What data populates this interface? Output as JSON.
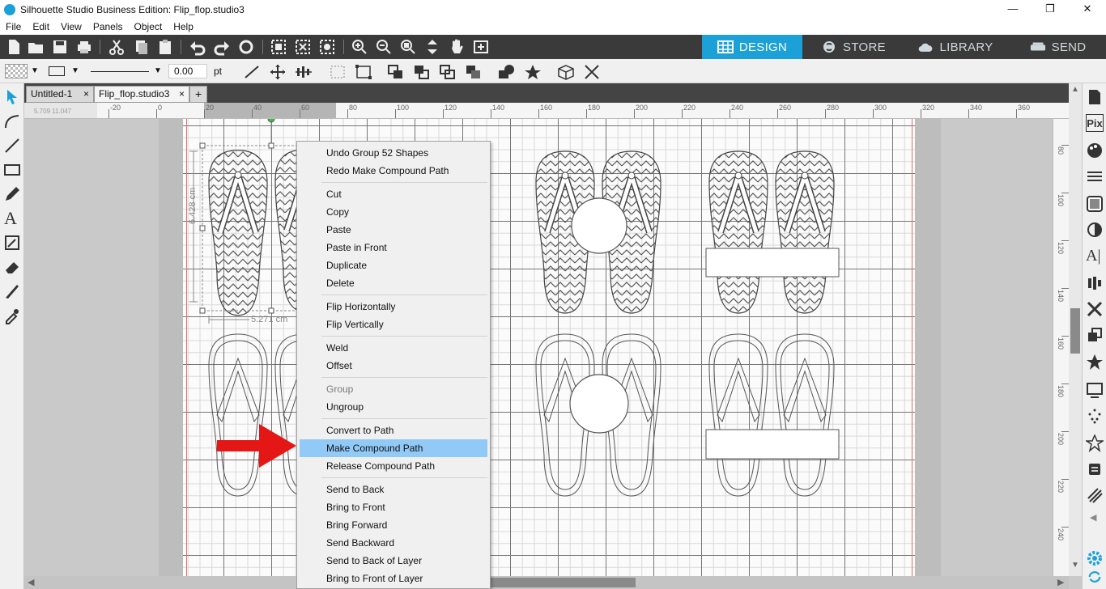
{
  "window": {
    "title": "Silhouette Studio Business Edition: Flip_flop.studio3",
    "controls": [
      "—",
      "❐",
      "✕"
    ]
  },
  "menubar": [
    "File",
    "Edit",
    "View",
    "Panels",
    "Object",
    "Help"
  ],
  "mode_tabs": [
    {
      "label": "DESIGN",
      "active": true
    },
    {
      "label": "STORE",
      "active": false
    },
    {
      "label": "LIBRARY",
      "active": false
    },
    {
      "label": "SEND",
      "active": false
    }
  ],
  "line_settings": {
    "width_value": "0.00",
    "unit": "pt"
  },
  "doc_tabs": [
    {
      "label": "Untitled-1",
      "close": "×"
    },
    {
      "label": "Flip_flop.studio3",
      "close": "×"
    },
    {
      "label": "+"
    }
  ],
  "ruler": {
    "mouse_readout": "5.709  11.047",
    "h_ticks": [
      "-20",
      "0",
      "20",
      "40",
      "60",
      "80",
      "100",
      "120",
      "140",
      "160",
      "180",
      "200",
      "220",
      "240",
      "260",
      "280",
      "300",
      "320",
      "340",
      "360"
    ],
    "v_ticks": [
      "80",
      "100",
      "120",
      "140",
      "160",
      "180",
      "200",
      "220",
      "240"
    ]
  },
  "selection": {
    "height_label": "6.428 cm",
    "width_label": "5.271 cm"
  },
  "context_menu": {
    "groups": [
      [
        {
          "label": "Undo Group 52 Shapes"
        },
        {
          "label": "Redo Make Compound Path"
        }
      ],
      [
        {
          "label": "Cut"
        },
        {
          "label": "Copy"
        },
        {
          "label": "Paste"
        },
        {
          "label": "Paste in Front"
        },
        {
          "label": "Duplicate"
        },
        {
          "label": "Delete"
        }
      ],
      [
        {
          "label": "Flip Horizontally"
        },
        {
          "label": "Flip Vertically"
        }
      ],
      [
        {
          "label": "Weld"
        },
        {
          "label": "Offset"
        }
      ],
      [
        {
          "label": "Group",
          "disabled": true
        },
        {
          "label": "Ungroup"
        }
      ],
      [
        {
          "label": "Convert to Path"
        },
        {
          "label": "Make Compound Path",
          "highlighted": true
        },
        {
          "label": "Release Compound Path"
        }
      ],
      [
        {
          "label": "Send to Back"
        },
        {
          "label": "Bring to Front"
        },
        {
          "label": "Bring Forward"
        },
        {
          "label": "Send Backward"
        },
        {
          "label": "Send to Back of Layer"
        },
        {
          "label": "Bring to Front of Layer"
        }
      ]
    ]
  },
  "colors": {
    "accent": "#1ba1d8",
    "toolbar_dark": "#3a3a3a",
    "menu_highlight": "#91c9f7",
    "annotation_arrow": "#e51616"
  }
}
